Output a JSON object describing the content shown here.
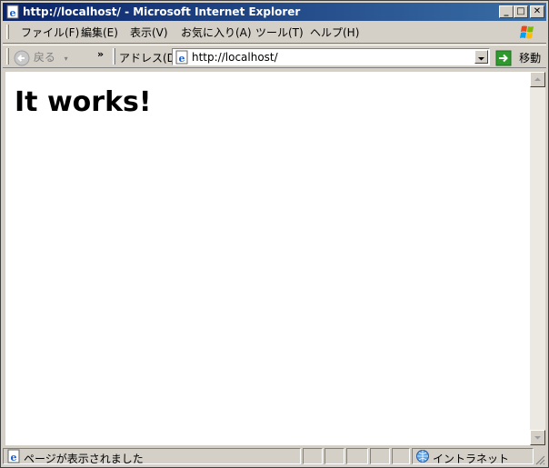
{
  "window": {
    "title": "http://localhost/ - Microsoft Internet Explorer",
    "controls": {
      "minimize": "_",
      "maximize": "□",
      "close": "✕"
    }
  },
  "menu": {
    "items": [
      {
        "label": "ファイル(F)"
      },
      {
        "label": "編集(E)"
      },
      {
        "label": "表示(V)"
      },
      {
        "label": "お気に入り(A)"
      },
      {
        "label": "ツール(T)"
      },
      {
        "label": "ヘルプ(H)"
      }
    ]
  },
  "toolbar": {
    "back_label": "戻る",
    "overflow": "»",
    "address_label": "アドレス(D)",
    "address_value": "http://localhost/",
    "go_label": "移動"
  },
  "page": {
    "heading": "It works!"
  },
  "status": {
    "text": "ページが表示されました",
    "zone": "イントラネット"
  },
  "icons": {
    "ie_page": "ie-page-icon",
    "windows_logo": "windows-logo-icon",
    "back_arrow": "back-arrow-icon",
    "go_arrow": "go-arrow-icon",
    "intranet": "intranet-globe-icon"
  },
  "colors": {
    "titlebar_start": "#0a246a",
    "titlebar_end": "#3a6ea5",
    "chrome": "#d4d0c8",
    "go_green": "#2e9a2e"
  }
}
